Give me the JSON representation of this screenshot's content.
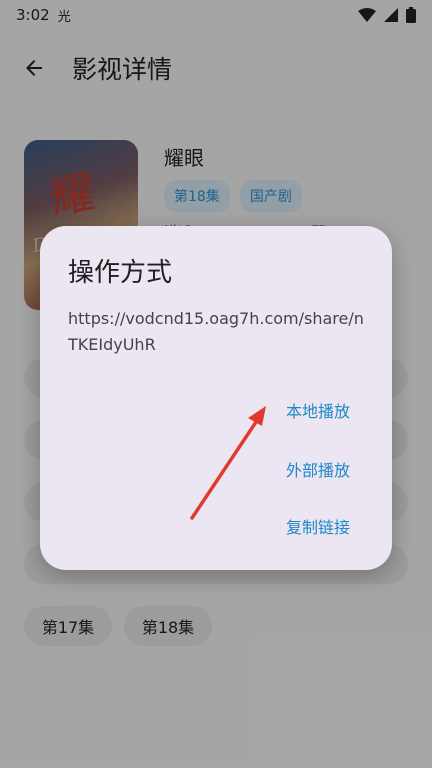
{
  "status_bar": {
    "time": "3:02",
    "notification_glyph": "光"
  },
  "app_bar": {
    "title": "影视详情"
  },
  "show": {
    "title": "耀眼",
    "tags": [
      "第18集",
      "国产剧"
    ],
    "description_fragment": "讲述……………………“那",
    "poster_title": "耀眼",
    "poster_subtitle": "Dazzling"
  },
  "episodes": {
    "rows": [
      [
        {
          "label": ""
        }
      ],
      [
        {
          "label": ""
        }
      ],
      [
        {
          "label": ""
        }
      ],
      [
        {
          "label": ""
        }
      ],
      [
        {
          "label": "第17集"
        },
        {
          "label": "第18集"
        }
      ]
    ]
  },
  "dialog": {
    "title": "操作方式",
    "url": "https://vodcnd15.oag7h.com/share/nTKEIdyUhR",
    "options": {
      "local_play": "本地播放",
      "external_play": "外部播放",
      "copy_link": "复制链接"
    }
  },
  "colors": {
    "accent": "#1e88c8",
    "arrow": "#e03a2f",
    "dialog_bg": "#ece6f2"
  },
  "icons": [
    "back-arrow-icon",
    "wifi-icon",
    "signal-icon",
    "battery-icon"
  ]
}
